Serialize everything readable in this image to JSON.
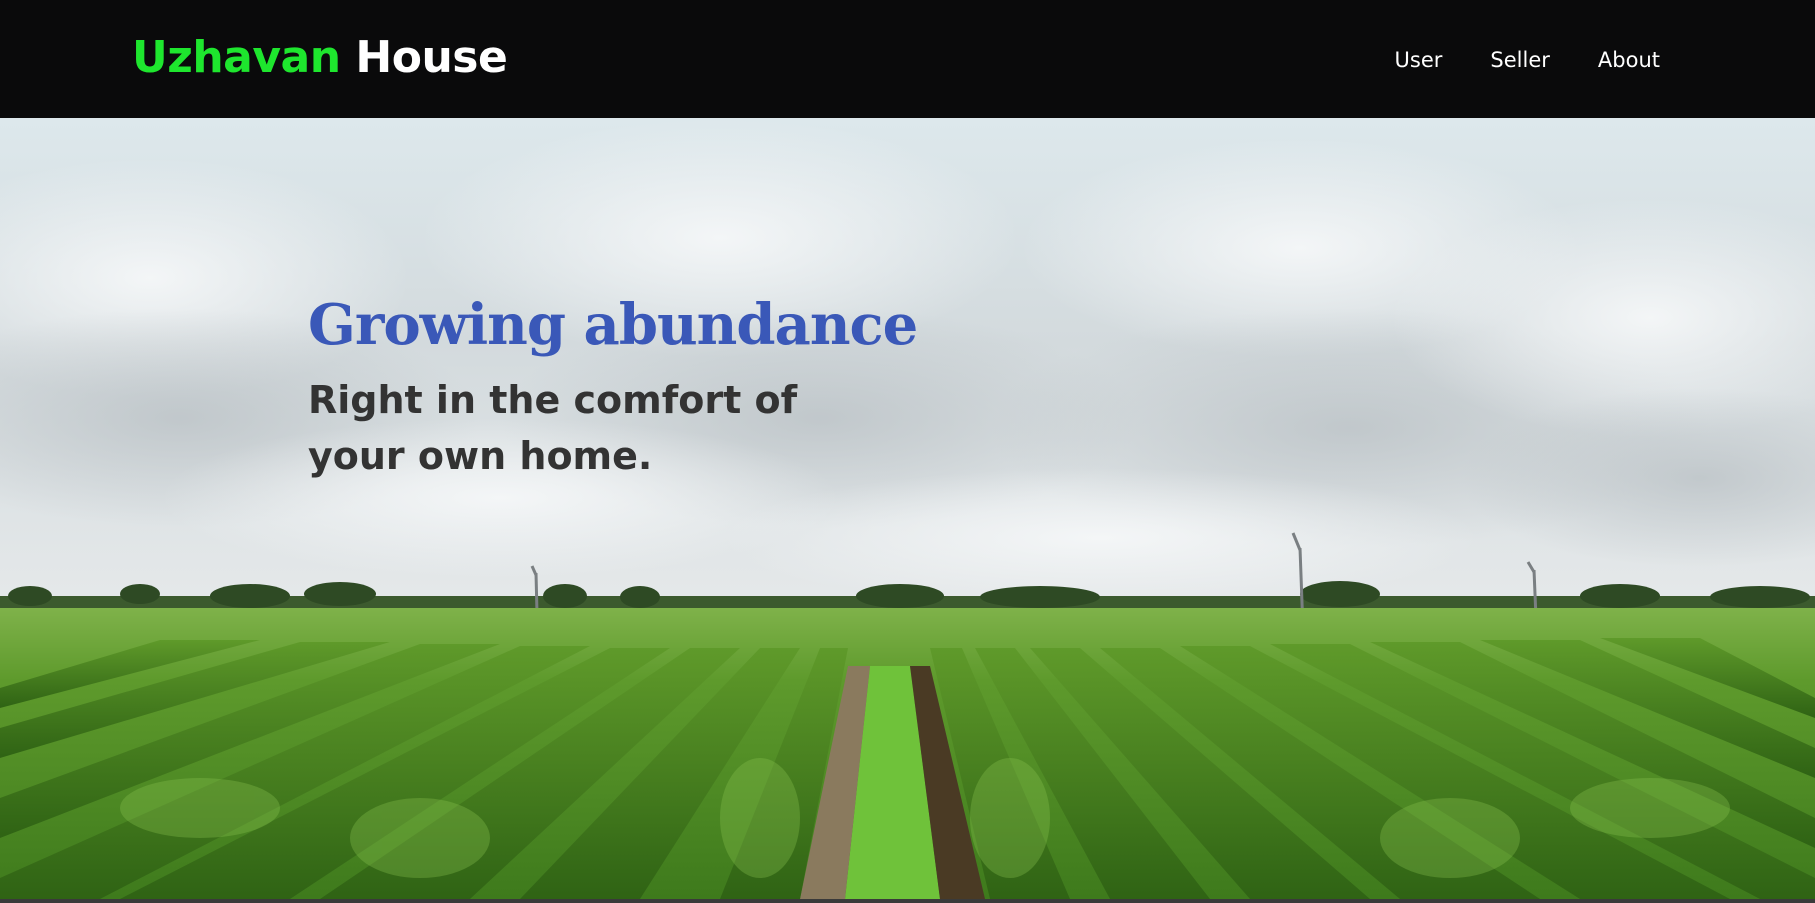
{
  "header": {
    "brand_first": "Uzhavan",
    "brand_second": "House",
    "nav": [
      {
        "label": "User"
      },
      {
        "label": "Seller"
      },
      {
        "label": "About"
      }
    ]
  },
  "hero": {
    "title": "Growing abundance",
    "subtitle": "Right in the comfort of your own home.",
    "background": "vineyard-rows-under-cloudy-sky"
  },
  "colors": {
    "brand_accent": "#1ee62e",
    "navbar_bg": "#0a0a0b",
    "hero_title": "#3a58b8",
    "hero_subtitle": "#333333"
  }
}
